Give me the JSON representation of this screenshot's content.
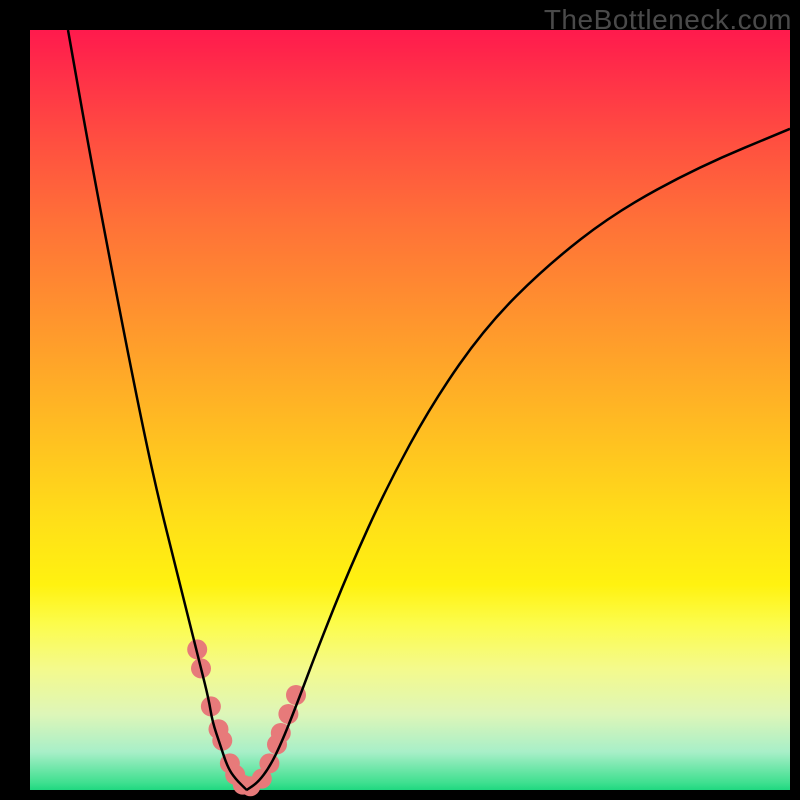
{
  "watermark": "TheBottleneck.com",
  "chart_data": {
    "type": "line",
    "title": "",
    "xlabel": "",
    "ylabel": "",
    "xlim": [
      0,
      100
    ],
    "ylim": [
      0,
      100
    ],
    "grid": false,
    "legend": false,
    "curves": {
      "left": {
        "x": [
          5,
          8,
          12,
          15,
          17,
          19,
          21,
          22.5,
          23.5,
          24,
          25,
          26,
          27,
          28.5
        ],
        "y": [
          100,
          83,
          62,
          47,
          38,
          30,
          22,
          16,
          12,
          9,
          6,
          3,
          1.5,
          0
        ]
      },
      "right": {
        "x": [
          28.5,
          30,
          31.5,
          33,
          35,
          38,
          42,
          47,
          53,
          60,
          68,
          77,
          88,
          100
        ],
        "y": [
          0,
          1,
          3,
          6,
          11,
          19,
          29,
          40,
          51,
          61,
          69,
          76,
          82,
          87
        ]
      }
    },
    "markers": {
      "comment": "highlighted pink marker points near the minimum",
      "x": [
        22.0,
        22.5,
        23.8,
        24.8,
        25.3,
        26.3,
        27.0,
        28.0,
        29.0,
        30.5,
        31.5,
        32.5,
        33.0,
        34.0,
        35.0
      ],
      "y": [
        18.5,
        16.0,
        11.0,
        8.0,
        6.5,
        3.5,
        2.0,
        0.7,
        0.5,
        1.5,
        3.5,
        6.0,
        7.5,
        10.0,
        12.5
      ]
    },
    "marker_style": {
      "color": "#e77a7a",
      "radius_px": 10
    }
  }
}
